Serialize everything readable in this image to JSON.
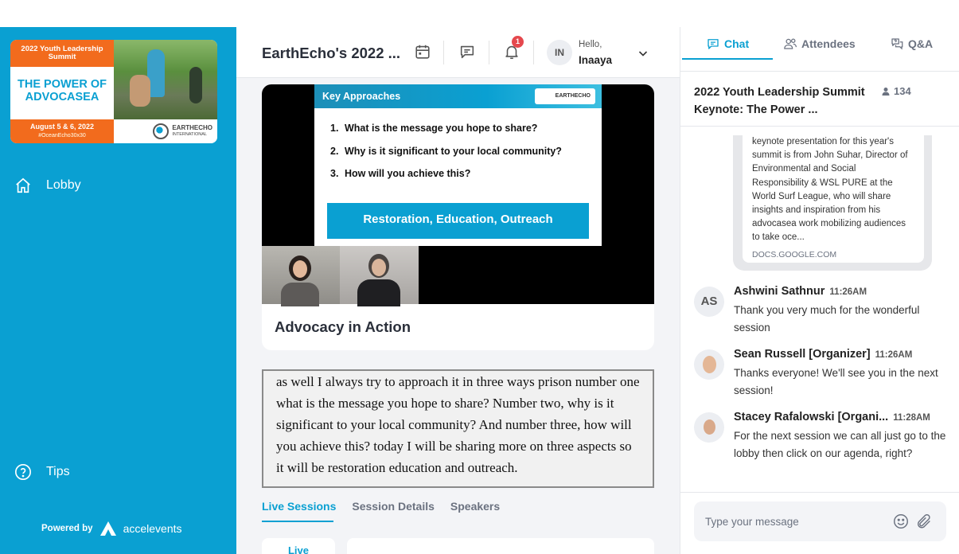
{
  "sidebar": {
    "banner": {
      "top_line1": "2022 Youth Leadership",
      "top_line2": "Summit",
      "mid_line1": "THE POWER OF",
      "mid_line2": "ADVOCASEA",
      "dates": "August 5 & 6, 2022",
      "hashtag": "#OceanEcho30x30",
      "logo_line1": "EARTHECHO",
      "logo_line2": "INTERNATIONAL"
    },
    "nav": [
      {
        "label": "Lobby",
        "icon": "home-icon"
      },
      {
        "label": "Tips",
        "icon": "help-circle-icon"
      }
    ],
    "powered_by": "Powered by",
    "powered_brand": "accelevents",
    "accent": "#0aa0d2"
  },
  "header": {
    "event_title": "EarthEcho's 2022 ...",
    "notification_count": "1",
    "user_initials": "IN",
    "greeting": "Hello,",
    "user_name": "Inaaya"
  },
  "video": {
    "slide_title": "Key Approaches",
    "slide_logo": "EARTHECHO",
    "slide_items": [
      {
        "n": "1.",
        "text": "What is the message you hope to share?"
      },
      {
        "n": "2.",
        "text": "Why is it significant to your local community?"
      },
      {
        "n": "3.",
        "text": "How will you achieve this?"
      }
    ],
    "slide_button": "Restoration, Education, Outreach",
    "session_name": "Advocacy in Action"
  },
  "captions": {
    "text": "as well I always try to approach it in three ways prison number one what is the message you hope to share? Number two, why is it significant to your local community? And number three, how will you achieve this? today I will be sharing more on three aspects so it will be restoration education and outreach."
  },
  "tabs": [
    {
      "label": "Live Sessions",
      "active": true
    },
    {
      "label": "Session Details",
      "active": false
    },
    {
      "label": "Speakers",
      "active": false
    }
  ],
  "bottom_card_label": "Live",
  "right_panel": {
    "tabs": [
      {
        "label": "Chat",
        "active": true
      },
      {
        "label": "Attendees",
        "active": false
      },
      {
        "label": "Q&A",
        "active": false
      }
    ],
    "session_title": "2022 Youth Leadership Summit Keynote: The Power ...",
    "attendee_count": "134",
    "link_preview": {
      "text": "keynote presentation for this year's summit is from John Suhar, Director of Environmental and Social Responsibility & WSL PURE at the World Surf League, who will share insights and inspiration from his advocasea work mobilizing audiences to take oce...",
      "domain": "DOCS.GOOGLE.COM"
    },
    "messages": [
      {
        "initials": "AS",
        "name": "Ashwini Sathnur",
        "time": "11:26AM",
        "text": "Thank you very much for the wonderful session"
      },
      {
        "initials": "",
        "name": "Sean Russell [Organizer]",
        "time": "11:26AM",
        "text": "Thanks everyone! We'll see you in the next session!"
      },
      {
        "initials": "",
        "name": "Stacey Rafalowski [Organi...",
        "time": "11:28AM",
        "text": "For the next session we can all just go to the lobby then click on our agenda, right?"
      }
    ],
    "composer_placeholder": "Type your message"
  }
}
